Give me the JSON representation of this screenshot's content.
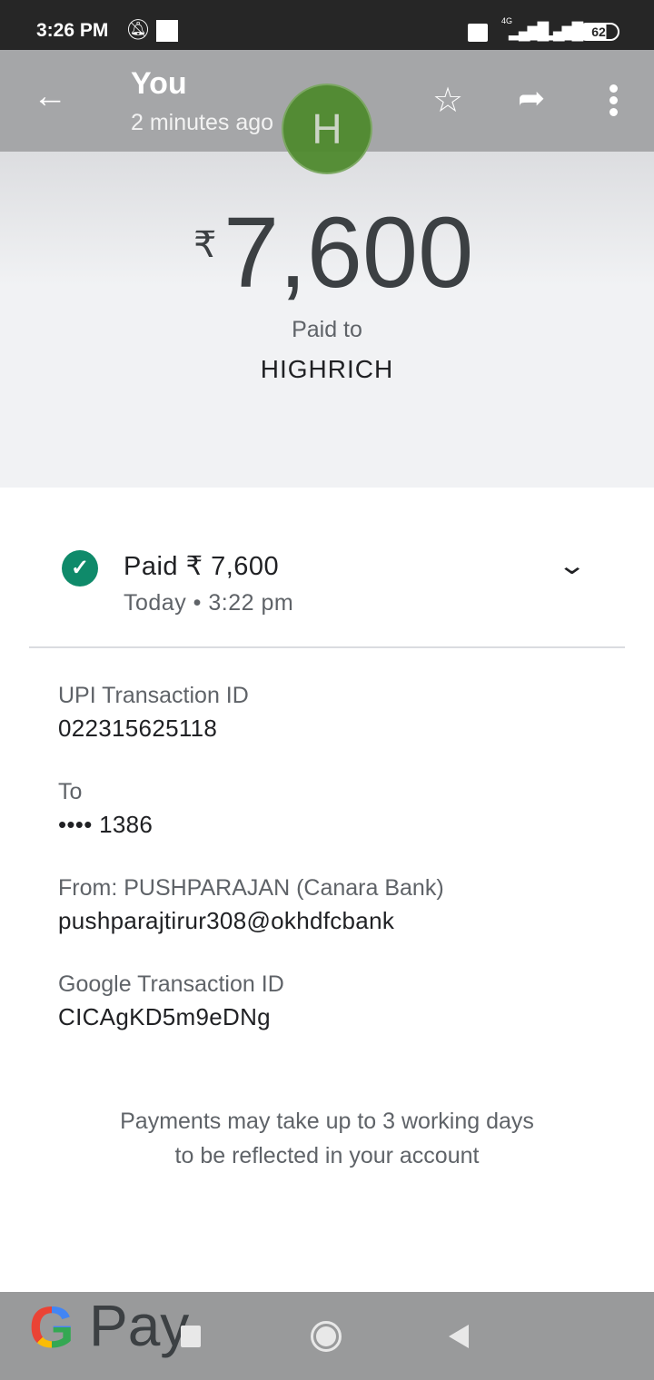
{
  "status_bar": {
    "time": "3:26 PM",
    "battery": "62",
    "network": "4G"
  },
  "app_bar": {
    "title": "You",
    "subtitle": "2 minutes ago",
    "avatar_letter": "H",
    "avatar_color": "#4f8a2e"
  },
  "hero": {
    "currency": "₹",
    "amount": "7,600",
    "paid_to_label": "Paid to",
    "payee": "HIGHRICH"
  },
  "status": {
    "title": "Paid ₹ 7,600",
    "time": "Today • 3:22 pm",
    "color": "#0f8a6a"
  },
  "details": [
    {
      "label": "UPI Transaction ID",
      "value": "022315625118"
    },
    {
      "label": "To",
      "value": "•••• 1386"
    },
    {
      "label": "From: PUSHPARAJAN (Canara Bank)",
      "value": "pushparajtirur308@okhdfcbank"
    },
    {
      "label": "Google Transaction ID",
      "value": "CICAgKD5m9eDNg"
    }
  ],
  "note": {
    "line1": "Payments may take up to 3 working days",
    "line2": "to be reflected in your account"
  },
  "footer": {
    "logo_text": "Pay"
  }
}
